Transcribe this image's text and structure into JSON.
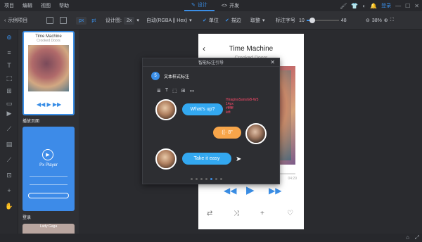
{
  "menu": [
    "项目",
    "编辑",
    "视图",
    "帮助"
  ],
  "mode_tabs": [
    {
      "label": "设计",
      "icon": "pencil-icon",
      "active": true
    },
    {
      "label": "开发",
      "icon": "code-icon",
      "active": false
    }
  ],
  "login_label": "登录",
  "toolbar": {
    "back_label": "示例项目",
    "unit_px": "px",
    "unit_pt": "pt",
    "design_label": "设计图:",
    "design_value": "2x",
    "color_format": "自动(RGBA || Hex)",
    "unit_check": "单位",
    "stroke_check": "描边",
    "round_label": "取整",
    "font_size_label": "标注字号",
    "font_size_min": "10",
    "font_size_max": "48",
    "zoom": "38%"
  },
  "thumbnails": [
    {
      "title": "Time Machine",
      "sub": "Crooked Doors",
      "label": ""
    },
    {
      "title": "Px Player",
      "label": "播放页面"
    },
    {
      "title": "Lady Gaga",
      "label": "登录"
    }
  ],
  "phone": {
    "title": "Time Machine",
    "subtitle": "Crooked Doors",
    "time_end": "04:29"
  },
  "modal": {
    "title": "智能标注引导",
    "step": "5",
    "step_title": "文本样式标注",
    "messages": [
      {
        "text": "What's up?",
        "side": "left",
        "color": "#33a8f0"
      },
      {
        "text": "8\"",
        "side": "right",
        "color": "#f7a54a"
      },
      {
        "text": "Take it easy",
        "side": "left",
        "color": "#33a8f0"
      }
    ],
    "annotation": [
      "HiraginoSansGB-W3",
      "14px",
      "#ffffff",
      "left"
    ],
    "page_count": 7,
    "page_active": 5
  },
  "colors": {
    "accent": "#3a8ee6",
    "bubble_blue": "#33a8f0",
    "bubble_orange": "#f7a54a",
    "annotation": "#ff4a6a"
  }
}
